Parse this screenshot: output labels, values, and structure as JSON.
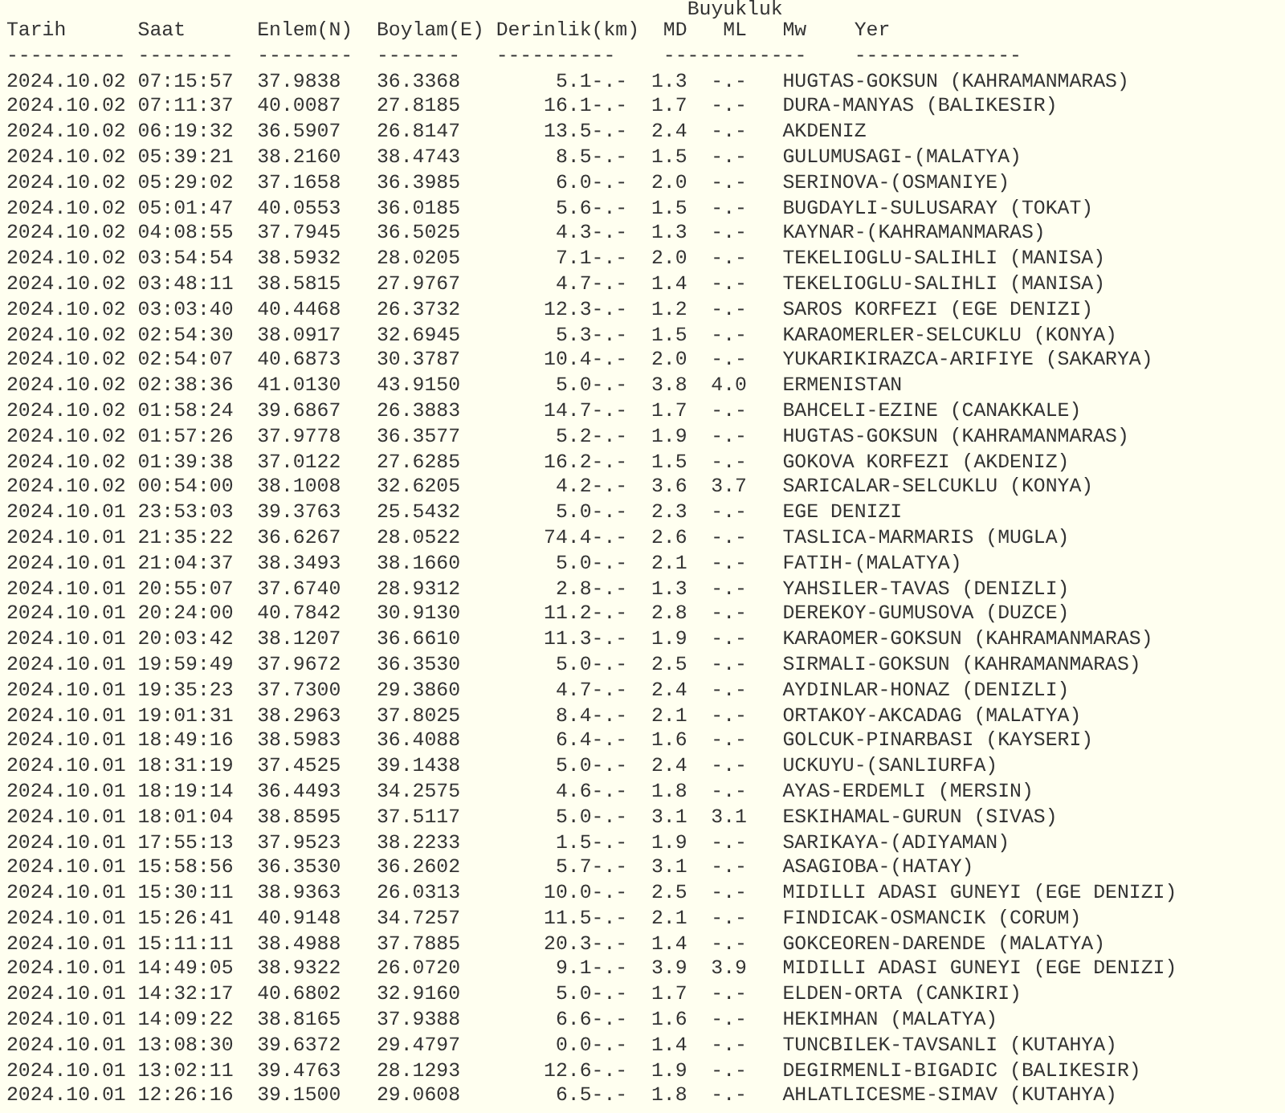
{
  "group_header": "Buyukluk",
  "columns": [
    "Tarih",
    "Saat",
    "Enlem(N)",
    "Boylam(E)",
    "Derinlik(km)",
    "MD",
    "ML",
    "Mw",
    "Yer"
  ],
  "separators": [
    "----------",
    "--------",
    "--------",
    "-------",
    "----------",
    "------------",
    "--------------"
  ],
  "rows": [
    [
      "2024.10.02",
      "07:15:57",
      "37.9838",
      "36.3368",
      "5.1",
      "-.-",
      "1.3",
      "-.-",
      "HUGTAS-GOKSUN (KAHRAMANMARAS)"
    ],
    [
      "2024.10.02",
      "07:11:37",
      "40.0087",
      "27.8185",
      "16.1",
      "-.-",
      "1.7",
      "-.-",
      "DURA-MANYAS (BALIKESIR)"
    ],
    [
      "2024.10.02",
      "06:19:32",
      "36.5907",
      "26.8147",
      "13.5",
      "-.-",
      "2.4",
      "-.-",
      "AKDENIZ"
    ],
    [
      "2024.10.02",
      "05:39:21",
      "38.2160",
      "38.4743",
      "8.5",
      "-.-",
      "1.5",
      "-.-",
      "GULUMUSAGI-(MALATYA)"
    ],
    [
      "2024.10.02",
      "05:29:02",
      "37.1658",
      "36.3985",
      "6.0",
      "-.-",
      "2.0",
      "-.-",
      "SERINOVA-(OSMANIYE)"
    ],
    [
      "2024.10.02",
      "05:01:47",
      "40.0553",
      "36.0185",
      "5.6",
      "-.-",
      "1.5",
      "-.-",
      "BUGDAYLI-SULUSARAY (TOKAT)"
    ],
    [
      "2024.10.02",
      "04:08:55",
      "37.7945",
      "36.5025",
      "4.3",
      "-.-",
      "1.3",
      "-.-",
      "KAYNAR-(KAHRAMANMARAS)"
    ],
    [
      "2024.10.02",
      "03:54:54",
      "38.5932",
      "28.0205",
      "7.1",
      "-.-",
      "2.0",
      "-.-",
      "TEKELIOGLU-SALIHLI (MANISA)"
    ],
    [
      "2024.10.02",
      "03:48:11",
      "38.5815",
      "27.9767",
      "4.7",
      "-.-",
      "1.4",
      "-.-",
      "TEKELIOGLU-SALIHLI (MANISA)"
    ],
    [
      "2024.10.02",
      "03:03:40",
      "40.4468",
      "26.3732",
      "12.3",
      "-.-",
      "1.2",
      "-.-",
      "SAROS KORFEZI (EGE DENIZI)"
    ],
    [
      "2024.10.02",
      "02:54:30",
      "38.0917",
      "32.6945",
      "5.3",
      "-.-",
      "1.5",
      "-.-",
      "KARAOMERLER-SELCUKLU (KONYA)"
    ],
    [
      "2024.10.02",
      "02:54:07",
      "40.6873",
      "30.3787",
      "10.4",
      "-.-",
      "2.0",
      "-.-",
      "YUKARIKIRAZCA-ARIFIYE (SAKARYA)"
    ],
    [
      "2024.10.02",
      "02:38:36",
      "41.0130",
      "43.9150",
      "5.0",
      "-.-",
      "3.8",
      "4.0",
      "ERMENISTAN"
    ],
    [
      "2024.10.02",
      "01:58:24",
      "39.6867",
      "26.3883",
      "14.7",
      "-.-",
      "1.7",
      "-.-",
      "BAHCELI-EZINE (CANAKKALE)"
    ],
    [
      "2024.10.02",
      "01:57:26",
      "37.9778",
      "36.3577",
      "5.2",
      "-.-",
      "1.9",
      "-.-",
      "HUGTAS-GOKSUN (KAHRAMANMARAS)"
    ],
    [
      "2024.10.02",
      "01:39:38",
      "37.0122",
      "27.6285",
      "16.2",
      "-.-",
      "1.5",
      "-.-",
      "GOKOVA KORFEZI (AKDENIZ)"
    ],
    [
      "2024.10.02",
      "00:54:00",
      "38.1008",
      "32.6205",
      "4.2",
      "-.-",
      "3.6",
      "3.7",
      "SARICALAR-SELCUKLU (KONYA)"
    ],
    [
      "2024.10.01",
      "23:53:03",
      "39.3763",
      "25.5432",
      "5.0",
      "-.-",
      "2.3",
      "-.-",
      "EGE DENIZI"
    ],
    [
      "2024.10.01",
      "21:35:22",
      "36.6267",
      "28.0522",
      "74.4",
      "-.-",
      "2.6",
      "-.-",
      "TASLICA-MARMARIS (MUGLA)"
    ],
    [
      "2024.10.01",
      "21:04:37",
      "38.3493",
      "38.1660",
      "5.0",
      "-.-",
      "2.1",
      "-.-",
      "FATIH-(MALATYA)"
    ],
    [
      "2024.10.01",
      "20:55:07",
      "37.6740",
      "28.9312",
      "2.8",
      "-.-",
      "1.3",
      "-.-",
      "YAHSILER-TAVAS (DENIZLI)"
    ],
    [
      "2024.10.01",
      "20:24:00",
      "40.7842",
      "30.9130",
      "11.2",
      "-.-",
      "2.8",
      "-.-",
      "DEREKOY-GUMUSOVA (DUZCE)"
    ],
    [
      "2024.10.01",
      "20:03:42",
      "38.1207",
      "36.6610",
      "11.3",
      "-.-",
      "1.9",
      "-.-",
      "KARAOMER-GOKSUN (KAHRAMANMARAS)"
    ],
    [
      "2024.10.01",
      "19:59:49",
      "37.9672",
      "36.3530",
      "5.0",
      "-.-",
      "2.5",
      "-.-",
      "SIRMALI-GOKSUN (KAHRAMANMARAS)"
    ],
    [
      "2024.10.01",
      "19:35:23",
      "37.7300",
      "29.3860",
      "4.7",
      "-.-",
      "2.4",
      "-.-",
      "AYDINLAR-HONAZ (DENIZLI)"
    ],
    [
      "2024.10.01",
      "19:01:31",
      "38.2963",
      "37.8025",
      "8.4",
      "-.-",
      "2.1",
      "-.-",
      "ORTAKOY-AKCADAG (MALATYA)"
    ],
    [
      "2024.10.01",
      "18:49:16",
      "38.5983",
      "36.4088",
      "6.4",
      "-.-",
      "1.6",
      "-.-",
      "GOLCUK-PINARBASI (KAYSERI)"
    ],
    [
      "2024.10.01",
      "18:31:19",
      "37.4525",
      "39.1438",
      "5.0",
      "-.-",
      "2.4",
      "-.-",
      "UCKUYU-(SANLIURFA)"
    ],
    [
      "2024.10.01",
      "18:19:14",
      "36.4493",
      "34.2575",
      "4.6",
      "-.-",
      "1.8",
      "-.-",
      "AYAS-ERDEMLI (MERSIN)"
    ],
    [
      "2024.10.01",
      "18:01:04",
      "38.8595",
      "37.5117",
      "5.0",
      "-.-",
      "3.1",
      "3.1",
      "ESKIHAMAL-GURUN (SIVAS)"
    ],
    [
      "2024.10.01",
      "17:55:13",
      "37.9523",
      "38.2233",
      "1.5",
      "-.-",
      "1.9",
      "-.-",
      "SARIKAYA-(ADIYAMAN)"
    ],
    [
      "2024.10.01",
      "15:58:56",
      "36.3530",
      "36.2602",
      "5.7",
      "-.-",
      "3.1",
      "-.-",
      "ASAGIOBA-(HATAY)"
    ],
    [
      "2024.10.01",
      "15:30:11",
      "38.9363",
      "26.0313",
      "10.0",
      "-.-",
      "2.5",
      "-.-",
      "MIDILLI ADASI GUNEYI (EGE DENIZI)"
    ],
    [
      "2024.10.01",
      "15:26:41",
      "40.9148",
      "34.7257",
      "11.5",
      "-.-",
      "2.1",
      "-.-",
      "FINDICAK-OSMANCIK (CORUM)"
    ],
    [
      "2024.10.01",
      "15:11:11",
      "38.4988",
      "37.7885",
      "20.3",
      "-.-",
      "1.4",
      "-.-",
      "GOKCEOREN-DARENDE (MALATYA)"
    ],
    [
      "2024.10.01",
      "14:49:05",
      "38.9322",
      "26.0720",
      "9.1",
      "-.-",
      "3.9",
      "3.9",
      "MIDILLI ADASI GUNEYI (EGE DENIZI)"
    ],
    [
      "2024.10.01",
      "14:32:17",
      "40.6802",
      "32.9160",
      "5.0",
      "-.-",
      "1.7",
      "-.-",
      "ELDEN-ORTA (CANKIRI)"
    ],
    [
      "2024.10.01",
      "14:09:22",
      "38.8165",
      "37.9388",
      "6.6",
      "-.-",
      "1.6",
      "-.-",
      "HEKIMHAN (MALATYA)"
    ],
    [
      "2024.10.01",
      "13:08:30",
      "39.6372",
      "29.4797",
      "0.0",
      "-.-",
      "1.4",
      "-.-",
      "TUNCBILEK-TAVSANLI (KUTAHYA)"
    ],
    [
      "2024.10.01",
      "13:02:11",
      "39.4763",
      "28.1293",
      "12.6",
      "-.-",
      "1.9",
      "-.-",
      "DEGIRMENLI-BIGADIC (BALIKESIR)"
    ],
    [
      "2024.10.01",
      "12:26:16",
      "39.1500",
      "29.0608",
      "6.5",
      "-.-",
      "1.8",
      "-.-",
      "AHLATLICESME-SIMAV (KUTAHYA)"
    ]
  ]
}
